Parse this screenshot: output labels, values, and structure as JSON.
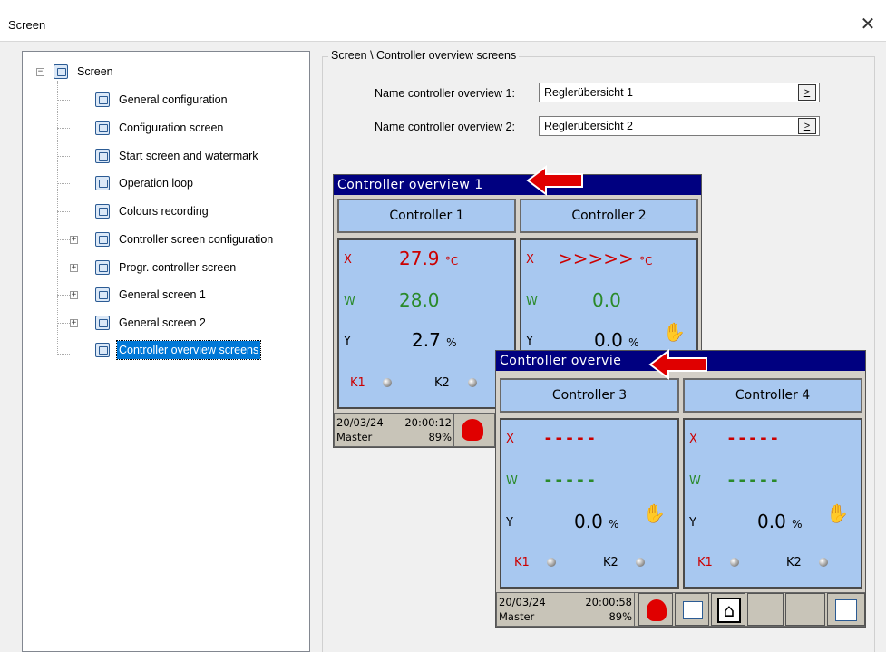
{
  "window": {
    "title": "Screen",
    "close_glyph": "✕"
  },
  "tree": {
    "root": "Screen",
    "items": [
      {
        "label": "General configuration",
        "icon": "gear-icon"
      },
      {
        "label": "Configuration screen",
        "icon": "grid-icon"
      },
      {
        "label": "Start screen and watermark",
        "icon": "picture-icon"
      },
      {
        "label": "Operation loop",
        "icon": "loop-icon"
      },
      {
        "label": "Colours recording",
        "icon": "palette-icon"
      },
      {
        "label": "Controller screen configuration",
        "icon": "screen-icon"
      },
      {
        "label": "Progr. controller screen",
        "icon": "screen-icon"
      },
      {
        "label": "General screen 1",
        "icon": "chart-icon"
      },
      {
        "label": "General screen 2",
        "icon": "chart-icon"
      },
      {
        "label": "Controller overview screens",
        "icon": "overview-icon"
      }
    ],
    "selected": "Controller overview screens",
    "expand_glyph": "+",
    "collapse_glyph": "−"
  },
  "group": {
    "title": "Screen \\ Controller overview screens"
  },
  "fields": {
    "name1_label": "Name controller overview 1:",
    "name1_value": "Reglerübersicht 1",
    "name2_label": "Name controller overview 2:",
    "name2_value": "Reglerübersicht 2",
    "browse_label": ">"
  },
  "overview1": {
    "title": "Controller overview 1",
    "c1": {
      "label": "Controller 1",
      "x_label": "X",
      "x_value": "27.9",
      "x_unit": "°C",
      "w_label": "W",
      "w_value": "28.0",
      "y_label": "Y",
      "y_value": "2.7",
      "y_unit": "%",
      "k1": "K1",
      "k2": "K2"
    },
    "c2": {
      "label": "Controller 2",
      "x_label": "X",
      "x_value": ">>>>>",
      "x_unit": "°C",
      "w_label": "W",
      "w_value": "0.0",
      "y_label": "Y",
      "y_value": "0.0",
      "y_unit": "%"
    },
    "status": {
      "date": "20/03/24",
      "time": "20:00:12",
      "mode": "Master",
      "percent": "89%"
    }
  },
  "overview2": {
    "title": "Controller overvie",
    "c3": {
      "label": "Controller 3",
      "x_label": "X",
      "x_value": "-----",
      "w_label": "W",
      "w_value": "-----",
      "y_label": "Y",
      "y_value": "0.0",
      "y_unit": "%",
      "k1": "K1",
      "k2": "K2"
    },
    "c4": {
      "label": "Controller 4",
      "x_label": "X",
      "x_value": "-----",
      "w_label": "W",
      "w_value": "-----",
      "y_label": "Y",
      "y_value": "0.0",
      "y_unit": "%",
      "k1": "K1",
      "k2": "K2"
    },
    "status": {
      "date": "20/03/24",
      "time": "20:00:58",
      "mode": "Master",
      "percent": "89%"
    }
  },
  "colors": {
    "header": "#000080",
    "panel_bg": "#a8c8f0",
    "red": "#cc0000",
    "green": "#2a8a2a",
    "selected": "#0078d7",
    "arrow": "#e00000"
  }
}
